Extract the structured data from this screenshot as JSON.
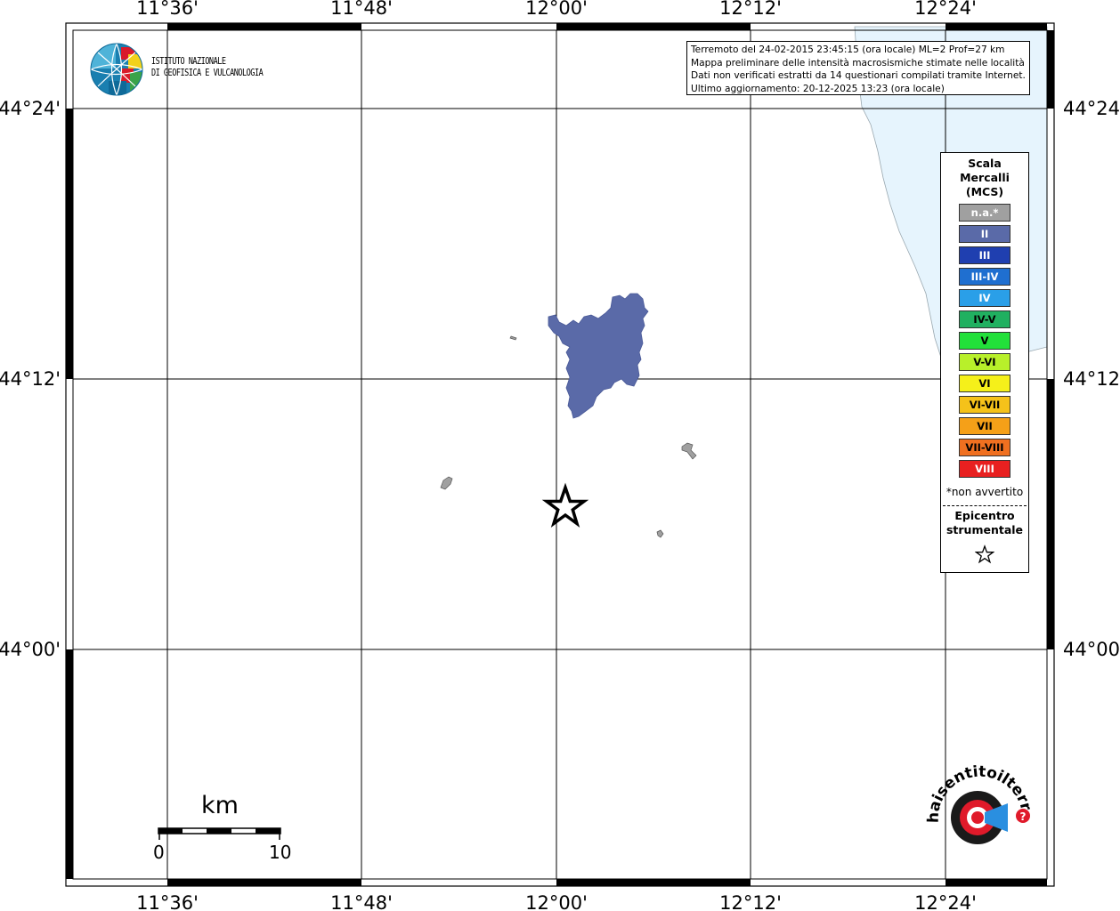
{
  "map": {
    "lon_labels": [
      "11°36'",
      "11°48'",
      "12°00'",
      "12°12'",
      "12°24'"
    ],
    "lat_labels": [
      "44°24'",
      "44°12'",
      "44°00'"
    ]
  },
  "info": {
    "line1": "Terremoto del 24-02-2015 23:45:15 (ora locale) ML=2 Prof=27 km",
    "line2": "Mappa preliminare delle intensità macrosismiche stimate nelle località",
    "line3": "Dati non verificati estratti da 14 questionari compilati tramite Internet.",
    "line4": "Ultimo aggiornamento: 20-12-2025 13:23 (ora locale)"
  },
  "logo": {
    "line1": "ISTITUTO NAZIONALE",
    "line2": "DI GEOFISICA E VULCANOLOGIA"
  },
  "legend": {
    "title_line1": "Scala",
    "title_line2": "Mercalli",
    "title_line3": "(MCS)",
    "items": [
      {
        "label": "n.a.*",
        "color": "#a0a0a0",
        "text_color": "#ffffff"
      },
      {
        "label": "II",
        "color": "#5a6aa8",
        "text_color": "#ffffff"
      },
      {
        "label": "III",
        "color": "#1f3fb0",
        "text_color": "#ffffff"
      },
      {
        "label": "III-IV",
        "color": "#1f6fd0",
        "text_color": "#ffffff"
      },
      {
        "label": "IV",
        "color": "#2a9fe8",
        "text_color": "#ffffff"
      },
      {
        "label": "IV-V",
        "color": "#20b060",
        "text_color": "#000000"
      },
      {
        "label": "V",
        "color": "#22e03a",
        "text_color": "#000000"
      },
      {
        "label": "V-VI",
        "color": "#b8f02a",
        "text_color": "#000000"
      },
      {
        "label": "VI",
        "color": "#f5f01a",
        "text_color": "#000000"
      },
      {
        "label": "VI-VII",
        "color": "#f5c21a",
        "text_color": "#000000"
      },
      {
        "label": "VII",
        "color": "#f5a018",
        "text_color": "#000000"
      },
      {
        "label": "VII-VIII",
        "color": "#f07020",
        "text_color": "#000000"
      },
      {
        "label": "VIII",
        "color": "#e82020",
        "text_color": "#ffffff"
      }
    ],
    "note": "*non avvertito",
    "epicenter_line1": "Epicentro",
    "epicenter_line2": "strumentale"
  },
  "scale_bar": {
    "unit": "km",
    "start": "0",
    "end": "10"
  },
  "watermark": {
    "text": "haisentitoilterremoto.it www."
  },
  "colors": {
    "sea": "#e6f4fd",
    "intensity_II": "#5a6aa8",
    "not_felt": "#a0a0a0"
  }
}
